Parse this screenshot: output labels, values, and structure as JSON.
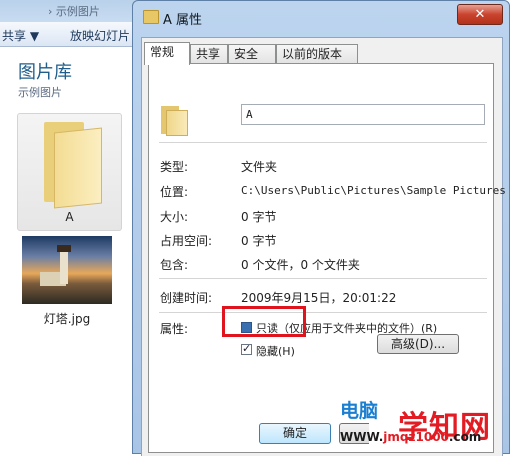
{
  "explorer": {
    "breadcrumb": "› 示例图片",
    "toolbar": {
      "share_label": "共享 ▼",
      "slideshow_label": "放映幻灯片"
    },
    "library_title": "图片库",
    "library_subtitle": "示例图片",
    "items": [
      {
        "name": "A",
        "icon": "folder-icon"
      },
      {
        "name": "灯塔.jpg",
        "icon": "image-thumbnail"
      }
    ]
  },
  "dialog": {
    "title": "A 属性",
    "close_label": "✕",
    "tabs": [
      "常规",
      "共享",
      "安全",
      "以前的版本"
    ],
    "active_tab": 0,
    "folder_name": "A",
    "fields": [
      {
        "label": "类型:",
        "value": "文件夹"
      },
      {
        "label": "位置:",
        "value": "C:\\Users\\Public\\Pictures\\Sample Pictures"
      },
      {
        "label": "大小:",
        "value": "0 字节"
      },
      {
        "label": "占用空间:",
        "value": "0 字节"
      },
      {
        "label": "包含:",
        "value": "0 个文件，0 个文件夹"
      }
    ],
    "created_label": "创建时间:",
    "created_value": "2009年9月15日，20:01:22",
    "attributes_label": "属性:",
    "readonly_label": "只读（仅应用于文件夹中的文件）(R)",
    "readonly_state": "indeterminate",
    "hidden_label": "隐藏(H)",
    "hidden_checked": true,
    "advanced_label": "高级(D)...",
    "ok_label": "确定"
  },
  "watermark": {
    "brand_blue": "电脑",
    "brand_red": "学知网",
    "url_prefix": "WWW.",
    "url_domain": "jmqz1000",
    "url_suffix": ".com"
  }
}
